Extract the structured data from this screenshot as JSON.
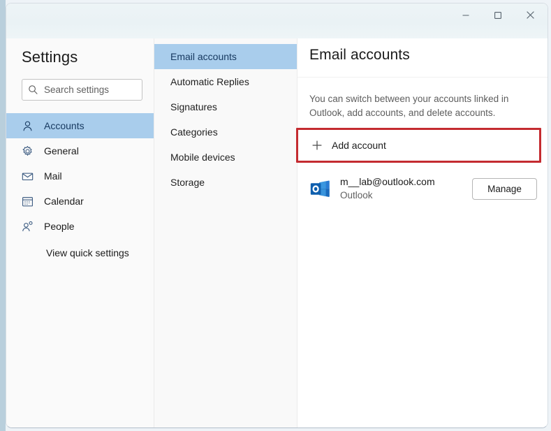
{
  "window": {
    "controls": {
      "minimize_label": "Minimize",
      "maximize_label": "Maximize",
      "close_label": "Close"
    }
  },
  "sidebar": {
    "title": "Settings",
    "search": {
      "placeholder": "Search settings",
      "value": "",
      "icon": "search-icon"
    },
    "items": [
      {
        "label": "Accounts",
        "icon": "person-icon",
        "selected": true
      },
      {
        "label": "General",
        "icon": "gear-icon",
        "selected": false
      },
      {
        "label": "Mail",
        "icon": "envelope-icon",
        "selected": false
      },
      {
        "label": "Calendar",
        "icon": "calendar-icon",
        "selected": false
      },
      {
        "label": "People",
        "icon": "people-icon",
        "selected": false
      }
    ],
    "quick_settings_label": "View quick settings"
  },
  "midcol": {
    "items": [
      {
        "label": "Email accounts",
        "selected": true
      },
      {
        "label": "Automatic Replies",
        "selected": false
      },
      {
        "label": "Signatures",
        "selected": false
      },
      {
        "label": "Categories",
        "selected": false
      },
      {
        "label": "Mobile devices",
        "selected": false
      },
      {
        "label": "Storage",
        "selected": false
      }
    ]
  },
  "main": {
    "title": "Email accounts",
    "description": "You can switch between your accounts linked in Outlook, add accounts, and delete accounts.",
    "add_account_label": "Add account",
    "add_account_icon": "plus-icon",
    "account": {
      "icon": "outlook-icon",
      "email": "m__lab@outlook.com",
      "provider": "Outlook",
      "manage_label": "Manage"
    }
  },
  "annotation": {
    "highlight_color": "#c42b30",
    "target": "Add account"
  },
  "colors": {
    "selection_blue": "#a9cdec",
    "selection_text": "#16385f",
    "sidebar_bg": "#fafafa",
    "midcol_bg": "#f9f9f9",
    "content_bg": "#ffffff",
    "titlebar_bg": "#eaf2f5"
  }
}
